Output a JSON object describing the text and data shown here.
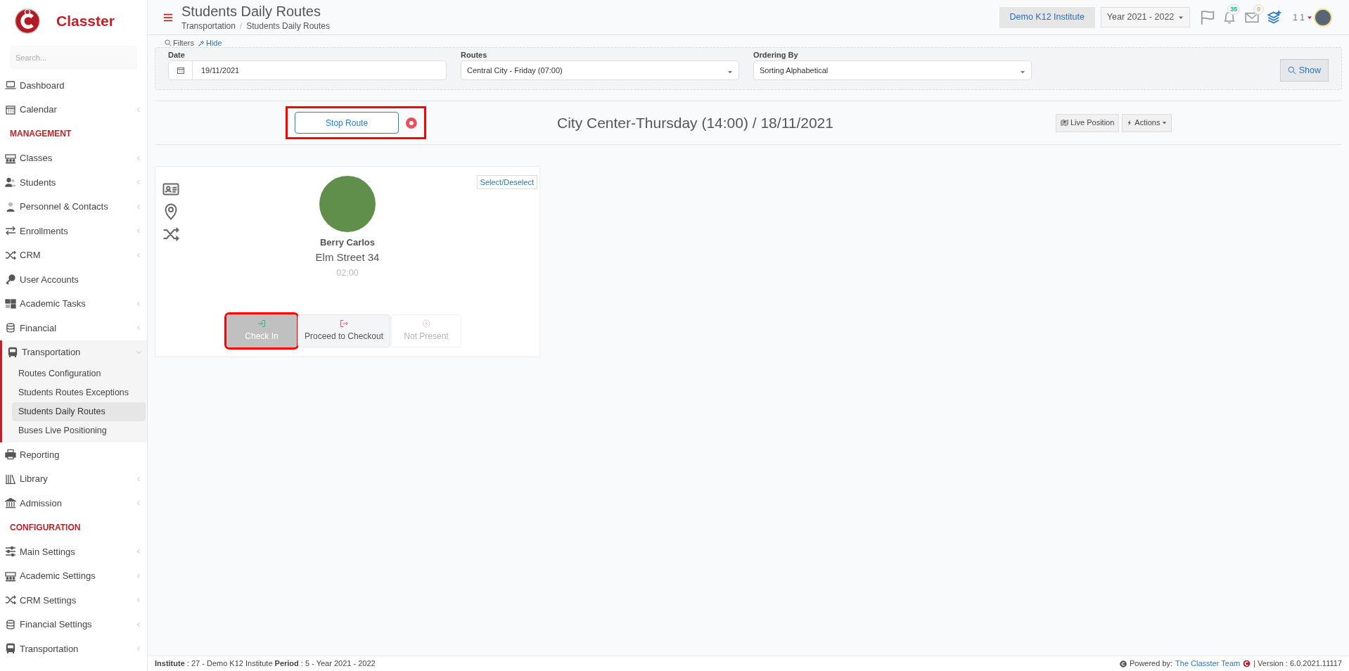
{
  "brand": {
    "name": "Classter"
  },
  "header": {
    "title": "Students Daily Routes",
    "breadcrumb": [
      "Transportation",
      "Students Daily Routes"
    ],
    "breadcrumb_separator": "/",
    "institute": "Demo K12 Institute",
    "year": "Year 2021 - 2022",
    "notifications": "35",
    "messages": "0",
    "user": "1 1"
  },
  "sidebar": {
    "search_placeholder": "Search...",
    "items": [
      {
        "kind": "item",
        "label": "Dashboard",
        "has_submenu": false,
        "expanded": false
      },
      {
        "kind": "item",
        "label": "Calendar",
        "has_submenu": true,
        "expanded": false
      },
      {
        "kind": "section",
        "label": "MANAGEMENT"
      },
      {
        "kind": "item",
        "label": "Classes",
        "has_submenu": true,
        "expanded": false
      },
      {
        "kind": "item",
        "label": "Students",
        "has_submenu": true,
        "expanded": false
      },
      {
        "kind": "item",
        "label": "Personnel & Contacts",
        "has_submenu": true,
        "expanded": false
      },
      {
        "kind": "item",
        "label": "Enrollments",
        "has_submenu": true,
        "expanded": false
      },
      {
        "kind": "item",
        "label": "CRM",
        "has_submenu": true,
        "expanded": false
      },
      {
        "kind": "item",
        "label": "User Accounts",
        "has_submenu": false,
        "expanded": false
      },
      {
        "kind": "item",
        "label": "Academic Tasks",
        "has_submenu": true,
        "expanded": false
      },
      {
        "kind": "item",
        "label": "Financial",
        "has_submenu": true,
        "expanded": false
      },
      {
        "kind": "item",
        "label": "Transportation",
        "has_submenu": true,
        "expanded": true,
        "children": [
          {
            "label": "Routes Configuration",
            "selected": false
          },
          {
            "label": "Students Routes Exceptions",
            "selected": false
          },
          {
            "label": "Students Daily Routes",
            "selected": true
          },
          {
            "label": "Buses Live Positioning",
            "selected": false
          }
        ]
      },
      {
        "kind": "item",
        "label": "Reporting",
        "has_submenu": false,
        "expanded": false
      },
      {
        "kind": "item",
        "label": "Library",
        "has_submenu": true,
        "expanded": false
      },
      {
        "kind": "item",
        "label": "Admission",
        "has_submenu": true,
        "expanded": false
      },
      {
        "kind": "section",
        "label": "CONFIGURATION"
      },
      {
        "kind": "item",
        "label": "Main Settings",
        "has_submenu": true,
        "expanded": false
      },
      {
        "kind": "item",
        "label": "Academic Settings",
        "has_submenu": true,
        "expanded": false
      },
      {
        "kind": "item",
        "label": "CRM Settings",
        "has_submenu": true,
        "expanded": false
      },
      {
        "kind": "item",
        "label": "Financial Settings",
        "has_submenu": true,
        "expanded": false
      },
      {
        "kind": "item",
        "label": "Transportation",
        "has_submenu": true,
        "expanded": false
      }
    ]
  },
  "filters": {
    "label": "Filters",
    "hide": "Hide",
    "fields": [
      {
        "kind": "date",
        "label": "Date",
        "value": "19/11/2021"
      },
      {
        "kind": "select",
        "label": "Routes",
        "value": "Central City - Friday (07:00)"
      },
      {
        "kind": "select",
        "label": "Ordering By",
        "value": "Sorting Alphabetical"
      }
    ],
    "show": "Show"
  },
  "route": {
    "stop_button": "Stop Route",
    "highlighted": true,
    "recording": true,
    "title": "City Center-Thursday (14:00) / 18/11/2021",
    "live_position": "Live Position",
    "actions": "Actions"
  },
  "students": [
    {
      "name": "Berry Carlos",
      "address": "Elm Street 34",
      "time": "02:00",
      "select": "Select/Deselect",
      "buttons": [
        {
          "kind": "checkin",
          "label": "Check In",
          "selected": true,
          "disabled": false,
          "highlighted": true
        },
        {
          "kind": "checkout",
          "label": "Proceed to Checkout",
          "selected": false,
          "disabled": false,
          "highlighted": false
        },
        {
          "kind": "absent",
          "label": "Not Present",
          "selected": false,
          "disabled": true,
          "highlighted": false
        }
      ]
    }
  ],
  "footer": {
    "info": "**Institute** : 27 - Demo K12 Institute **Period** : 5 - Year 2021 - 2022",
    "powered": "Powered by:",
    "team": "The Classter Team",
    "version": "| Version : 6.0.2021.11117"
  }
}
